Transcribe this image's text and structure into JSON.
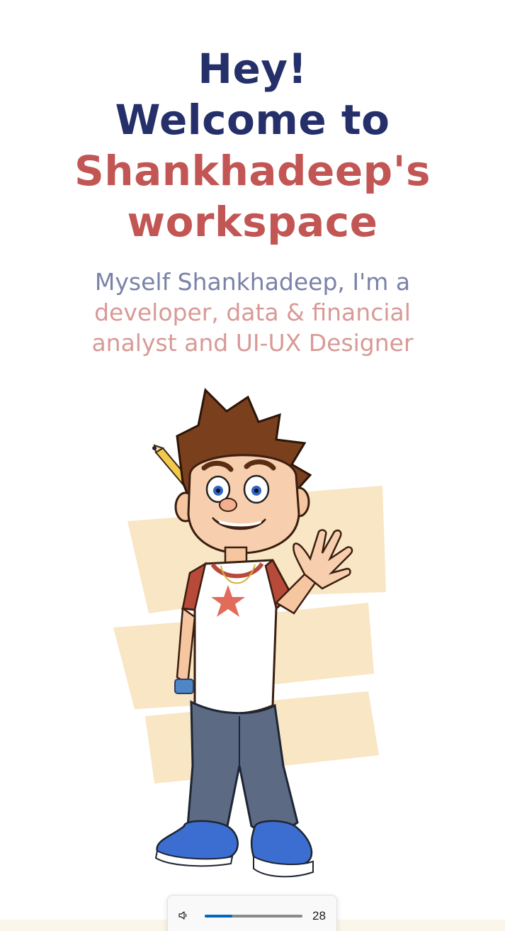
{
  "hero": {
    "line1": "Hey!",
    "line2": "Welcome to",
    "line3": "Shankhadeep's",
    "line4": "workspace"
  },
  "intro": {
    "line1": "Myself Shankhadeep, I'm a",
    "line2": "developer, data & financial",
    "line3": "analyst and UI-UX Designer"
  },
  "volume_popup": {
    "icon": "speaker-icon",
    "level": 28,
    "value_label": "28"
  },
  "colors": {
    "navy": "#252f6a",
    "red": "#c25654",
    "muted_navy": "#7a82a8",
    "muted_red": "#d89a97",
    "accent": "#0067c0"
  }
}
